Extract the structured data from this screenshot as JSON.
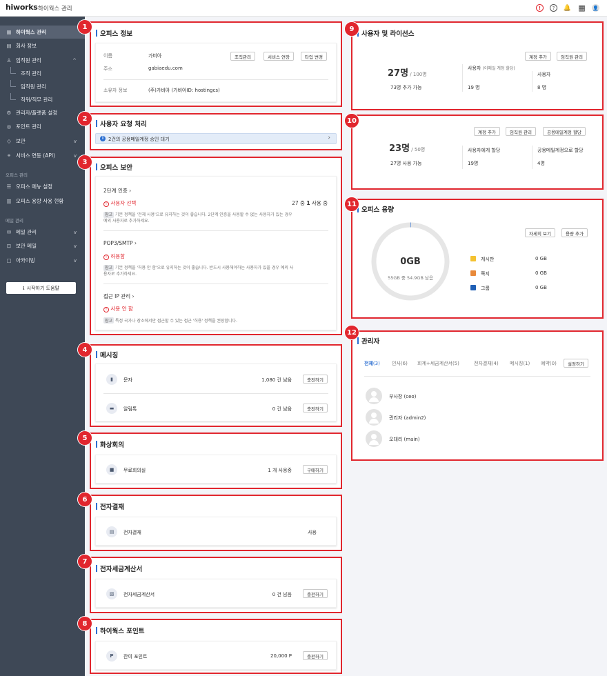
{
  "header": {
    "logo": "hiworks",
    "title": "하이웍스 관리",
    "alert_icon": "!",
    "help_icon": "?",
    "bell_icon": "🔔",
    "apps_icon": "▦",
    "profile_icon": "👤"
  },
  "sidebar": {
    "items": [
      {
        "label": "하이웍스 관리",
        "icon": "▦"
      },
      {
        "label": "회사 정보",
        "icon": "▤"
      },
      {
        "label": "임직원 관리",
        "icon": "♙",
        "chev": "^"
      },
      {
        "label": "조직 관리"
      },
      {
        "label": "임직원 관리"
      },
      {
        "label": "직위/직무 관리"
      },
      {
        "label": "관리자/플랫폼 설정",
        "icon": "⚙"
      },
      {
        "label": "포인트 관리",
        "icon": "◎"
      },
      {
        "label": "보안",
        "icon": "◇",
        "chev": "v"
      },
      {
        "label": "서비스 연동 (API)",
        "icon": "⚭",
        "chev": "v"
      },
      {
        "label": "오피스 메뉴 설정",
        "icon": "☰"
      },
      {
        "label": "오피스 용량 사용 현황",
        "icon": "▥"
      },
      {
        "label": "메일 관리",
        "icon": "✉",
        "chev": "v"
      },
      {
        "label": "보안 메일",
        "icon": "⊡",
        "chev": "v"
      },
      {
        "label": "아카이빙",
        "icon": "▢",
        "chev": "v"
      }
    ],
    "section_office": "오피스 관리",
    "section_mail": "메일 관리",
    "help_button": "시작하기 도움말",
    "help_icon": "ℹ"
  },
  "badges": [
    "1",
    "2",
    "3",
    "4",
    "5",
    "6",
    "7",
    "8",
    "9",
    "10",
    "11",
    "12"
  ],
  "office_info": {
    "title": "오피스 정보",
    "name_label": "이름",
    "name_value": "가비아",
    "address_label": "주소",
    "address_value": "gabiaedu.com",
    "owner_label": "소유자 정보",
    "owner_value": "(주)가비아 (가비아ID: hostingcs)",
    "buttons": [
      "조직관리",
      "서비스 연장",
      "타입 변경"
    ]
  },
  "user_requests": {
    "title": "사용자 요청 처리",
    "banner": "2건의 공용메일계정 승인 대기",
    "chevron": "›",
    "info_icon": "i"
  },
  "office_security": {
    "title": "오피스 보안",
    "two_factor_title": "2단계 인증",
    "two_factor_status": "사용자 선택",
    "two_factor_count_prefix": "27 중 ",
    "two_factor_count_value": "1",
    "two_factor_count_suffix": " 사용 중",
    "note_tag": "참고",
    "two_factor_note": "기본 정책을 '전체 사용'으로 유지하는 것이 좋습니다. 2단계 인증을 사용할 수 없는 사용자가 있는 경우",
    "two_factor_note2": "예외 사용자로 추가하세요.",
    "pop_title": "POP3/SMTP",
    "pop_status": "허용함",
    "pop_note": "기본 정책을 '허용 안 함'으로 유지하는 것이 좋습니다. 반드시 사용해야하는 사용자가 있을 경우 예외 사",
    "pop_note2": "용자로 추가하세요.",
    "ip_title": "접근 IP 관리",
    "ip_status": "사용 안 함",
    "ip_note": "특정 국가나 장소에서만 접근할 수 있는 접근 '허용' 정책을 권장합니다.",
    "warn_icon": "!"
  },
  "messaging": {
    "title": "메시징",
    "rows": [
      {
        "label": "문자",
        "value": "1,080 건 남음",
        "button": "충전하기",
        "icon": "▮"
      },
      {
        "label": "알림톡",
        "value": "0 건 남음",
        "button": "충전하기",
        "icon": "▬"
      }
    ]
  },
  "video": {
    "title": "화상회의",
    "label": "무료회의실",
    "value": "1 개 사용중",
    "button": "구매하기",
    "icon": "■"
  },
  "approval": {
    "title": "전자결재",
    "label": "전자결재",
    "value": "사용",
    "icon": "▤"
  },
  "tax": {
    "title": "전자세금계산서",
    "label": "전자세금계산서",
    "value": "0 건 남음",
    "button": "충전하기",
    "icon": "▧"
  },
  "points": {
    "title": "하이웍스 포인트",
    "label": "잔여 포인트",
    "value": "20,000 P",
    "button": "충전하기",
    "icon": "P"
  },
  "users": {
    "title": "사용자 및 라이선스",
    "buttons": [
      "계정 추가",
      "임직원 관리"
    ],
    "total": "27명",
    "total_of": "/ 100명",
    "available": "73명 추가 가능",
    "col1_label": "사용자",
    "col1_sub": "(이메일 계정 할당)",
    "col1_value": "19 명",
    "col2_label": "사용자",
    "col2_value": "8 명"
  },
  "shared": {
    "buttons": [
      "계정 추가",
      "임직원 관리",
      "공용메일계정 할당"
    ],
    "total": "23명",
    "total_of": "/ 50명",
    "used": "27명 사용 가능",
    "col1_label": "사용자에게 할당",
    "col1_value": "19명",
    "col2_label": "공용메일계정으로 할당",
    "col2_value": "4명"
  },
  "storage": {
    "title": "오피스 용량",
    "buttons": [
      "자세히 보기",
      "용량 추가"
    ],
    "big": "0GB",
    "sub": "55GB 중 54.9GB 남음",
    "used_fraction": 0.002,
    "ring_color": "#e6e6e6",
    "legend": [
      {
        "label": "게시판",
        "value": "0 GB",
        "color": "#f4c231"
      },
      {
        "label": "쪽지",
        "value": "0 GB",
        "color": "#e8893a"
      },
      {
        "label": "그룹",
        "value": "0 GB",
        "color": "#1f5fb5"
      }
    ]
  },
  "admins": {
    "title": "관리자",
    "tabs": [
      {
        "label": "전체",
        "count": "(3)"
      },
      {
        "label": "인사",
        "count": "(6)"
      },
      {
        "label": "회계+세금계산서",
        "count": "(5)"
      },
      {
        "label": "전자결재",
        "count": "(4)"
      },
      {
        "label": "메시징",
        "count": "(1)"
      },
      {
        "label": "예약",
        "count": "(0)"
      }
    ],
    "settings_button": "설정하기",
    "people": [
      "부사장 (ceo)",
      "관리자 (admin2)",
      "오대리 (main)"
    ]
  },
  "colors": {
    "accent": "#2c6fd1",
    "highlight": "#e1262e",
    "sidebar": "#3e4856"
  }
}
